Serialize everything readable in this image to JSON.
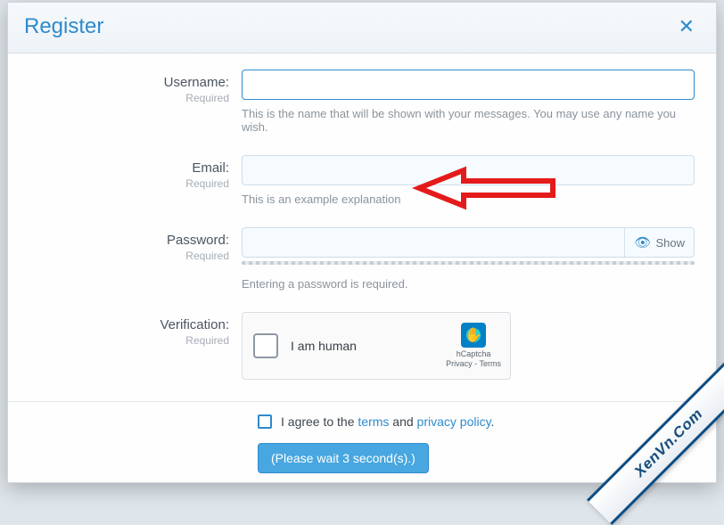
{
  "modal": {
    "title": "Register",
    "close_glyph": "✕"
  },
  "fields": {
    "username": {
      "label": "Username:",
      "required": "Required",
      "value": "",
      "help": "This is the name that will be shown with your messages. You may use any name you wish."
    },
    "email": {
      "label": "Email:",
      "required": "Required",
      "value": "",
      "help": "This is an example explanation"
    },
    "password": {
      "label": "Password:",
      "required": "Required",
      "value": "",
      "show_label": "Show",
      "help": "Entering a password is required."
    },
    "verification": {
      "label": "Verification:",
      "required": "Required",
      "captcha_label": "I am human",
      "brand": "hCaptcha",
      "privacy": "Privacy",
      "terms": "Terms"
    }
  },
  "agree": {
    "prefix": "I agree to the ",
    "terms": "terms",
    "mid": " and ",
    "privacy": "privacy policy",
    "suffix": "."
  },
  "submit": {
    "label": "(Please wait 3 second(s).)"
  },
  "ribbon": {
    "text": "XenVn.Com"
  }
}
